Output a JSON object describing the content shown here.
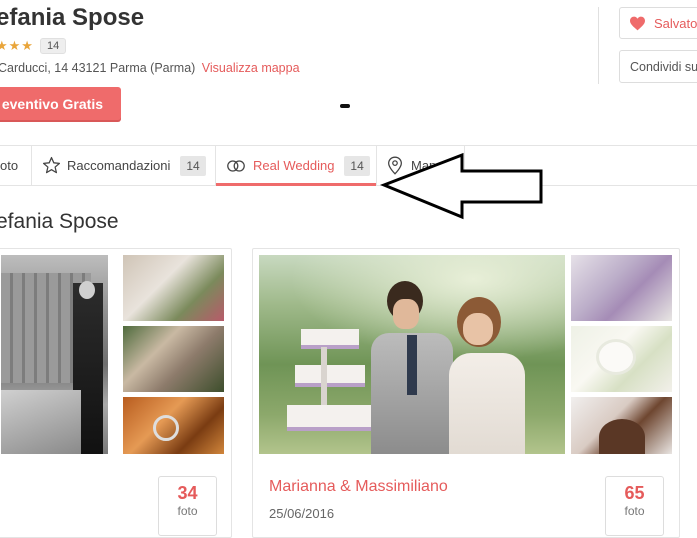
{
  "header": {
    "vendor_name": "efania Spose",
    "stars": "★★★",
    "review_count": "14",
    "address": "Carducci, 14 43121 Parma (Parma)",
    "map_link": "Visualizza mappa",
    "quote_button": "eventivo Gratis",
    "save_button": "Salvato",
    "share_button": "Condividi su"
  },
  "tabs": [
    {
      "label": "oto"
    },
    {
      "label": "Raccomandazioni",
      "count": "14",
      "icon": "star-outline-icon"
    },
    {
      "label": "Real Wedding",
      "count": "14",
      "icon": "rings-icon",
      "active": true
    },
    {
      "label": "Mappa",
      "icon": "map-pin-icon"
    }
  ],
  "section": {
    "title": "efania Spose"
  },
  "cards": [
    {
      "photo_count": "34",
      "photo_label": "foto"
    },
    {
      "couple": "Marianna & Massimiliano",
      "date": "25/06/2016",
      "photo_count": "65",
      "photo_label": "foto"
    }
  ],
  "colors": {
    "accent": "#ef6b6b",
    "star": "#e9a53a"
  }
}
